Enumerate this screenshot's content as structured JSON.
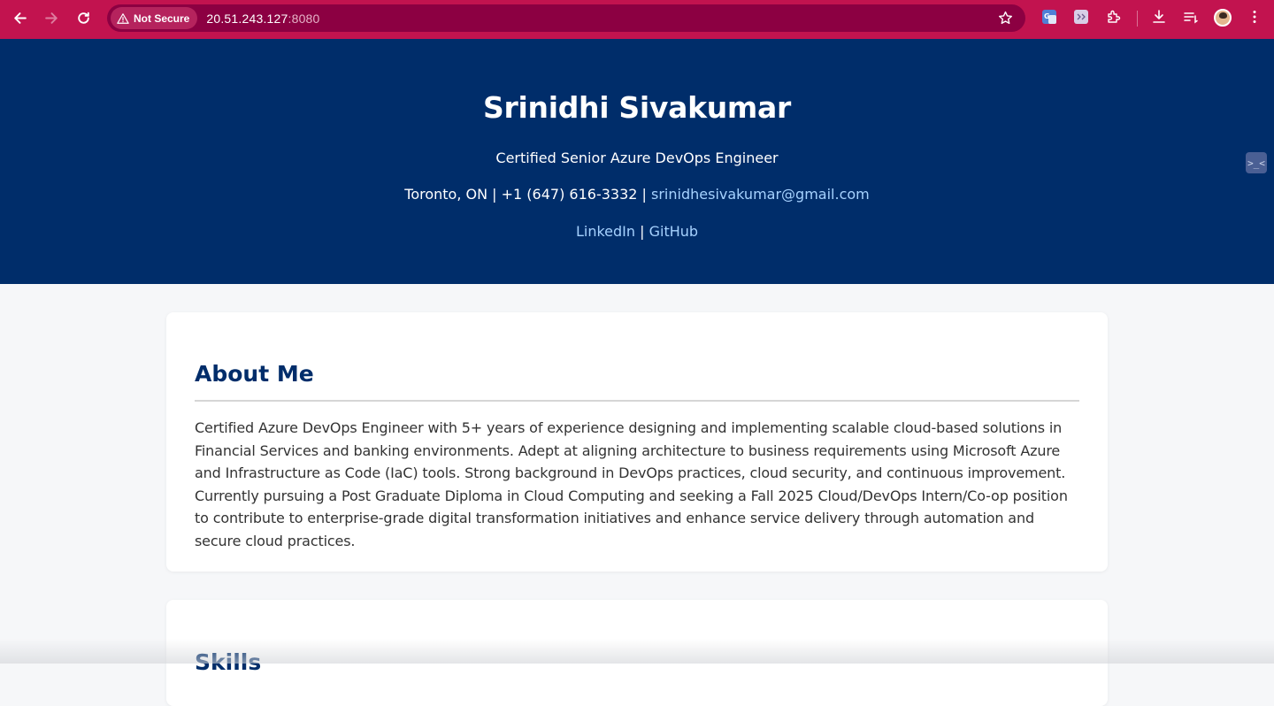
{
  "browser": {
    "security_label": "Not Secure",
    "url_host": "20.51.243.127",
    "url_port": ":8080",
    "toolbar_icons": [
      "back-icon",
      "forward-icon",
      "reload-icon",
      "warning-icon",
      "star-icon",
      "google-translate-icon",
      "extension-icon",
      "puzzle-icon",
      "download-icon",
      "reading-list-icon",
      "avatar",
      "kebab-menu-icon"
    ],
    "theme_color": "#c2134f"
  },
  "hero": {
    "name": "Srinidhi Sivakumar",
    "title": "Certified Senior Azure DevOps Engineer",
    "location_phone": "Toronto, ON | +1 (647) 616-3332 |",
    "email": "srinidhesivakumar@gmail.com",
    "linkedin": "LinkedIn",
    "separator": "|",
    "github": "GitHub",
    "background": "#002d6a",
    "link_color": "#a6d2ff"
  },
  "about": {
    "heading": "About Me",
    "text": "Certified Azure DevOps Engineer with 5+ years of experience designing and implementing scalable cloud-based solutions in Financial Services and banking environments. Adept at aligning architecture to business requirements using Microsoft Azure and Infrastructure as Code (IaC) tools. Strong background in DevOps practices, cloud security, and continuous improvement. Currently pursuing a Post Graduate Diploma in Cloud Computing and seeking a Fall 2025 Cloud/DevOps Intern/Co-op position to contribute to enterprise-grade digital transformation initiatives and enhance service delivery through automation and secure cloud practices."
  },
  "skills": {
    "heading": "Skills"
  }
}
